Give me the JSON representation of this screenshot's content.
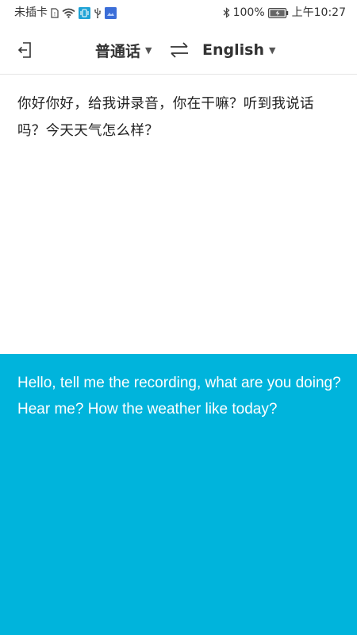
{
  "status_bar": {
    "carrier": "未插卡",
    "battery_percent": "100%",
    "time": "上午10:27"
  },
  "top_bar": {
    "source_language": "普通话",
    "target_language": "English",
    "dropdown_glyph": "▼"
  },
  "source": {
    "text": "你好你好，给我讲录音，你在干嘛？听到我说话吗？今天天气怎么样？"
  },
  "translation": {
    "text": "Hello, tell me the recording, what are you doing? Hear me? How the weather like today?"
  },
  "colors": {
    "translation_background": "#00b4dc",
    "accent_badge": "#1fa3d6"
  },
  "icons": {
    "exit": "exit-icon",
    "swap": "swap-icon",
    "sim": "sim-card-icon",
    "wifi": "wifi-icon",
    "vibrate": "vibrate-icon",
    "usb": "usb-icon",
    "bluetooth": "bluetooth-icon",
    "battery": "battery-icon"
  }
}
